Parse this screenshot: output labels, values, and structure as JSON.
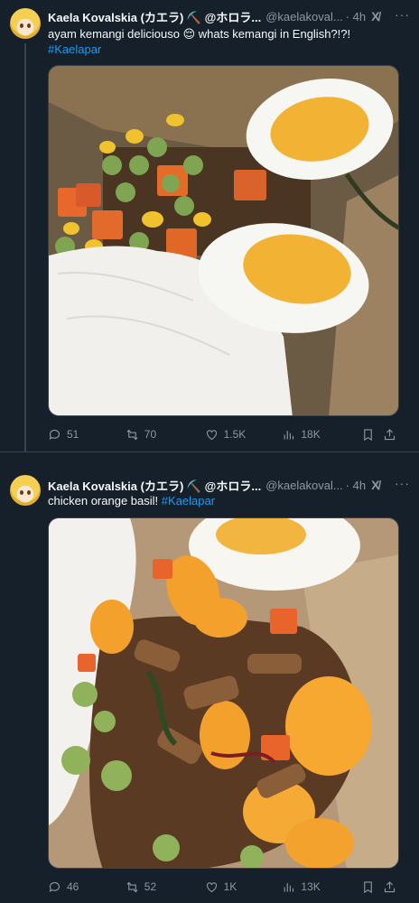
{
  "tweets": [
    {
      "name": "Kaela Kovalskia (カエラ) ⛏️ @ホロラ...",
      "handle": "@kaelakoval...",
      "time": "· 4h",
      "text": "ayam kemangi deliciouso 😌 whats kemangi in English?!?!",
      "hashtag": "#Kaelapar",
      "stats": {
        "replies": "51",
        "retweets": "70",
        "likes": "1.5K",
        "views": "18K"
      }
    },
    {
      "name": "Kaela Kovalskia (カエラ) ⛏️ @ホロラ...",
      "handle": "@kaelakoval...",
      "time": "· 4h",
      "text": "chicken orange basil!",
      "hashtag": "#Kaelapar",
      "stats": {
        "replies": "46",
        "retweets": "52",
        "likes": "1K",
        "views": "13K"
      }
    }
  ],
  "icons": [
    "grok-icon",
    "more-icon",
    "reply-icon",
    "retweet-icon",
    "like-icon",
    "views-icon",
    "bookmark-icon",
    "share-icon"
  ],
  "colors": {
    "background": "#15202b",
    "accent": "#1d9bf0",
    "muted": "#8b98a5",
    "border": "#38444d"
  }
}
